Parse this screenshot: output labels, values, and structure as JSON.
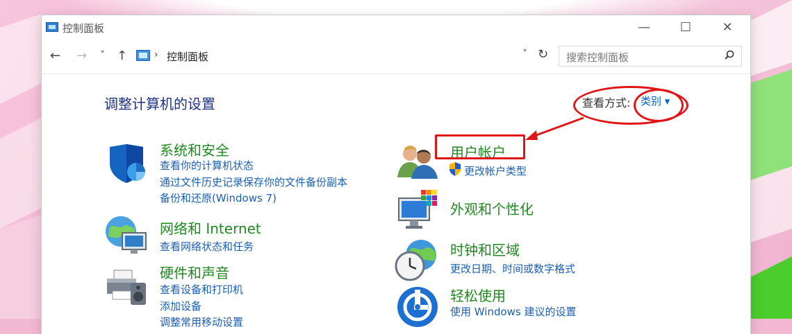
{
  "window": {
    "title": "控制面板",
    "minimize_glyph": "—",
    "maximize_glyph": "☐",
    "close_glyph": "✕"
  },
  "nav": {
    "back_glyph": "←",
    "forward_glyph": "→",
    "history_glyph": "˅",
    "up_glyph": "↑",
    "address_separator": "›",
    "address_path": "控制面板",
    "address_dropdown_glyph": "˅",
    "refresh_glyph": "↻",
    "search_placeholder": "搜索控制面板"
  },
  "header": {
    "title": "调整计算机的设置",
    "view_by_label": "查看方式:",
    "view_by_value": "类别 ▾"
  },
  "categories_left": [
    {
      "icon": "shield-icon",
      "title": "系统和安全",
      "links": [
        "查看你的计算机状态",
        "通过文件历史记录保存你的文件备份副本",
        "备份和还原(Windows 7)"
      ]
    },
    {
      "icon": "network-globe-icon",
      "title": "网络和 Internet",
      "links": [
        "查看网络状态和任务"
      ]
    },
    {
      "icon": "printer-speaker-icon",
      "title": "硬件和声音",
      "links": [
        "查看设备和打印机",
        "添加设备",
        "调整常用移动设置"
      ]
    }
  ],
  "categories_right": [
    {
      "icon": "users-icon",
      "title": "用户帐户",
      "links": [
        "更改帐户类型"
      ]
    },
    {
      "icon": "monitor-palette-icon",
      "title": "外观和个性化",
      "links": []
    },
    {
      "icon": "clock-globe-icon",
      "title": "时钟和区域",
      "links": [
        "更改日期、时间或数字格式"
      ]
    },
    {
      "icon": "ease-of-access-icon",
      "title": "轻松使用",
      "links": [
        "使用 Windows 建议的设置"
      ]
    }
  ],
  "colors": {
    "title_blue": "#1e3287",
    "category_green": "#1f8a1f",
    "link_blue": "#1a5fb4",
    "annotation_red": "#e01616"
  }
}
